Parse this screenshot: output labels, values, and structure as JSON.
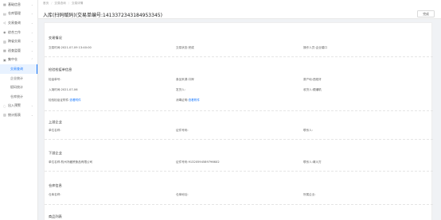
{
  "sidebar": {
    "items": [
      {
        "icon": "▦",
        "label": "基础信息",
        "expanded": false
      },
      {
        "icon": "▤",
        "label": "仓库管理",
        "expanded": false
      },
      {
        "icon": "◁",
        "label": "交易查询",
        "expanded": false
      },
      {
        "icon": "◉",
        "label": "综合工作",
        "expanded": false
      },
      {
        "icon": "▥",
        "label": "跨省交易",
        "expanded": false
      },
      {
        "icon": "▦",
        "label": "巡查监管",
        "expanded": false
      },
      {
        "icon": "▣",
        "label": "集中仓",
        "expanded": true
      }
    ],
    "sub_items": [
      {
        "label": "交易查询",
        "active": true
      },
      {
        "label": "企业统计",
        "active": false
      },
      {
        "label": "赋码统计",
        "active": false
      },
      {
        "label": "仓库统计",
        "active": false
      }
    ],
    "bottom_items": [
      {
        "icon": "◌",
        "label": "出入预警",
        "expanded": false
      },
      {
        "icon": "▥",
        "label": "统计报表",
        "expanded": false
      }
    ]
  },
  "breadcrumb": [
    "首页",
    "交易查询",
    "交易详情"
  ],
  "page_title": "入库(扫码赋码)(交易单编号:141337234318495334​5)",
  "back_label": "完成",
  "sections": {
    "trade": {
      "title": "交易情况",
      "f1_label": "交易时间:",
      "f1_value": "2021-07-09 13:40:00",
      "f2_label": "交易状态:",
      "f2_value": "完成",
      "f3_label": "操作人员:",
      "f3_value": "企业端口"
    },
    "quarantine": {
      "title": "检验检疫单信息",
      "f1_label": "检疫单号:",
      "f1_value": "",
      "f2_label": "食品来源:",
      "f2_value": "口岸",
      "f3_label": "原产地:",
      "f3_value": "西班牙",
      "f4_label": "入境时间:",
      "f4_value": "2021-07-06",
      "f5_label": "发货人:",
      "f5_value": "",
      "f6_label": "收货人:",
      "f6_value": "顺潮机",
      "f7_label": "检验检疫证附件:",
      "f7_value": "查看附件",
      "f8_label": "消毒证明:",
      "f8_value": "查看附件"
    },
    "upstream": {
      "title": "上游企业",
      "f1_label": "单位名称:",
      "f1_value": "",
      "f2_label": "证件号码:",
      "f2_value": "",
      "f3_label": "联系人:",
      "f3_value": ""
    },
    "downstream": {
      "title": "下游企业",
      "f1_label": "单位名称:",
      "f1_value": "杭州冷藏贸食品有限公司",
      "f2_label": "证件号码:",
      "f2_value": "91320594589796​6X2",
      "f3_label": "联系人:",
      "f3_value": "蒋川方"
    },
    "warehouse": {
      "title": "仓库信息",
      "f1_label": "仓库名称:",
      "f1_value": "",
      "f2_label": "仓库地址:",
      "f2_value": "",
      "f3_label": "所属企业:",
      "f3_value": ""
    },
    "goods": {
      "title": "商品列表"
    }
  }
}
